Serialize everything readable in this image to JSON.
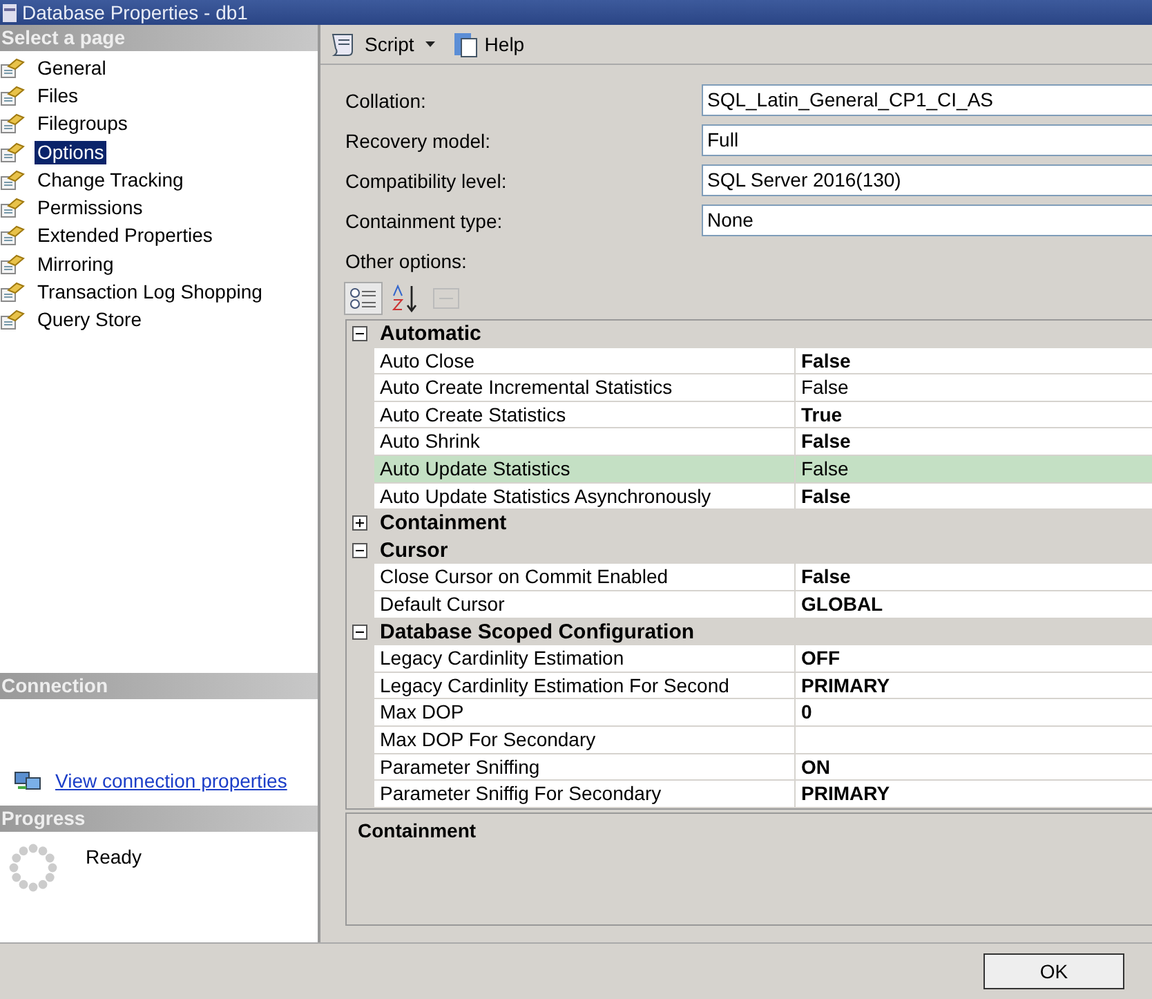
{
  "window": {
    "title": "Database Properties - db1"
  },
  "sidebar": {
    "header": "Select a page",
    "items": [
      {
        "label": "General",
        "selected": false
      },
      {
        "label": "Files",
        "selected": false
      },
      {
        "label": "Filegroups",
        "selected": false
      },
      {
        "label": "Options",
        "selected": true
      },
      {
        "label": "Change Tracking",
        "selected": false
      },
      {
        "label": "Permissions",
        "selected": false
      },
      {
        "label": "Extended Properties",
        "selected": false
      },
      {
        "label": "Mirroring",
        "selected": false
      },
      {
        "label": "Transaction Log Shopping",
        "selected": false
      },
      {
        "label": "Query Store",
        "selected": false
      }
    ]
  },
  "connection": {
    "header": "Connection",
    "link": "View connection properties"
  },
  "progress": {
    "header": "Progress",
    "status": "Ready"
  },
  "toolbar": {
    "script": "Script",
    "help": "Help"
  },
  "fields": [
    {
      "label": "Collation:",
      "value": "SQL_Latin_General_CP1_CI_AS"
    },
    {
      "label": "Recovery model:",
      "value": "Full"
    },
    {
      "label": "Compatibility level:",
      "value": "SQL Server 2016(130)"
    },
    {
      "label": "Containment type:",
      "value": "None"
    }
  ],
  "other_options_label": "Other options:",
  "grid": {
    "categories": [
      {
        "name": "Automatic",
        "expanded": true,
        "rows": [
          {
            "name": "Auto Close",
            "value": "False",
            "modified": true,
            "selected": false
          },
          {
            "name": "Auto Create Incremental Statistics",
            "value": "False",
            "modified": false,
            "selected": false
          },
          {
            "name": "Auto Create Statistics",
            "value": "True",
            "modified": true,
            "selected": false
          },
          {
            "name": "Auto Shrink",
            "value": "False",
            "modified": true,
            "selected": false
          },
          {
            "name": "Auto Update Statistics",
            "value": "False",
            "modified": false,
            "selected": true
          },
          {
            "name": "Auto Update Statistics Asynchronously",
            "value": "False",
            "modified": true,
            "selected": false
          }
        ]
      },
      {
        "name": "Containment",
        "expanded": false
      },
      {
        "name": "Cursor",
        "expanded": true,
        "rows": [
          {
            "name": "Close Cursor on Commit Enabled",
            "value": "False",
            "modified": true,
            "selected": false
          },
          {
            "name": "Default Cursor",
            "value": "GLOBAL",
            "modified": true,
            "selected": false
          }
        ]
      },
      {
        "name": "Database Scoped Configuration",
        "expanded": true,
        "rows": [
          {
            "name": "Legacy Cardinlity Estimation",
            "value": "OFF",
            "modified": true,
            "selected": false
          },
          {
            "name": "Legacy Cardinlity Estimation For Second",
            "value": "PRIMARY",
            "modified": true,
            "selected": false
          },
          {
            "name": "Max DOP",
            "value": "0",
            "modified": true,
            "selected": false
          },
          {
            "name": "Max DOP For Secondary",
            "selected": false
          },
          {
            "name": "Parameter Sniffing",
            "value": "ON",
            "modified": true,
            "selected": false
          },
          {
            "name": "Parameter Sniffig For Secondary",
            "value": "PRIMARY",
            "modified": true,
            "selected": false
          }
        ]
      }
    ]
  },
  "description": {
    "title": "Containment"
  },
  "buttons": [
    "OK"
  ]
}
